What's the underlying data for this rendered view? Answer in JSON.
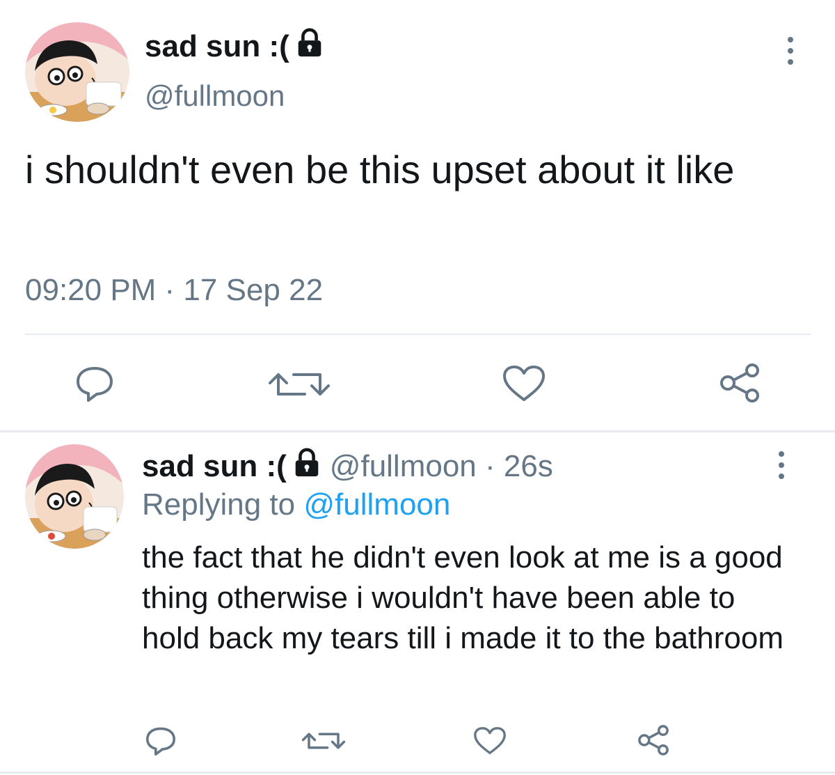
{
  "main_tweet": {
    "display_name": "sad sun :(",
    "handle": "@fullmoon",
    "text": "i shouldn't even be this upset about it like",
    "timestamp": "09:20 PM · 17 Sep 22",
    "icons": [
      "lock-icon",
      "more-vertical-icon",
      "reply-icon",
      "retweet-icon",
      "like-icon",
      "share-icon"
    ]
  },
  "reply_tweet": {
    "display_name": "sad sun :(",
    "handle_time": "@fullmoon · 26s",
    "replying_prefix": "Replying to",
    "replying_to": "@fullmoon",
    "text": "the fact that he didn't even look at me is a good thing otherwise i wouldn't have been able to hold back my tears till i made it to the bathroom",
    "icons": [
      "lock-icon",
      "more-vertical-icon",
      "reply-icon",
      "retweet-icon",
      "like-icon",
      "share-icon"
    ]
  },
  "colors": {
    "text": "#14171a",
    "secondary": "#657786",
    "link": "#1da1f2",
    "divider": "#e6ecf0"
  }
}
